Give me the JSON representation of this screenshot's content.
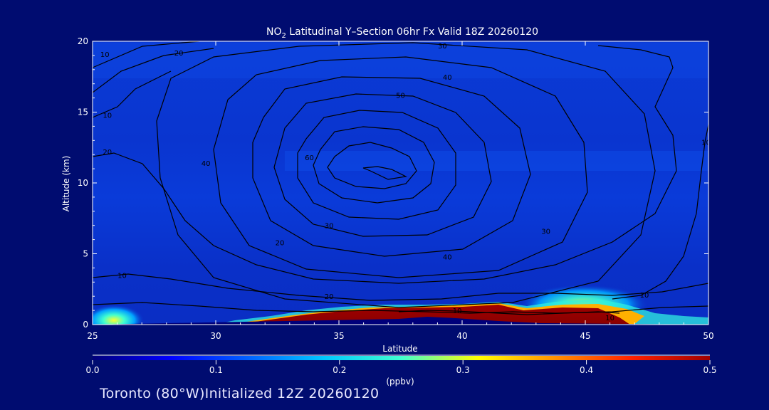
{
  "chart_data": {
    "type": "heatmap",
    "title_prefix": "NO",
    "title_sub": "2",
    "title_rest": " Latitudinal Y–Section 06hr  Fx Valid 18Z 20260120",
    "xlabel": "Latitude",
    "ylabel": "Altitude (km)",
    "xlim": [
      25,
      50
    ],
    "ylim": [
      0,
      20
    ],
    "xticks": [
      "25",
      "30",
      "35",
      "40",
      "45",
      "50"
    ],
    "yticks": [
      "0",
      "5",
      "10",
      "15",
      "20"
    ],
    "colorbar": {
      "label": "(ppbv)",
      "range": [
        0.0,
        0.5
      ],
      "ticks": [
        "0.0",
        "0.1",
        "0.2",
        "0.3",
        "0.4",
        "0.5"
      ],
      "colors": [
        "#00007a",
        "#0000ff",
        "#0060ff",
        "#00c8ff",
        "#40ffd0",
        "#ffff00",
        "#ff9000",
        "#ff2000",
        "#a00000"
      ]
    },
    "contour_labels": [
      {
        "text": "10",
        "x": 25.5,
        "y": 19.1
      },
      {
        "text": "20",
        "x": 28.5,
        "y": 19.2
      },
      {
        "text": "30",
        "x": 39.2,
        "y": 19.7
      },
      {
        "text": "40",
        "x": 39.4,
        "y": 17.5
      },
      {
        "text": "50",
        "x": 37.5,
        "y": 16.2
      },
      {
        "text": "10",
        "x": 25.6,
        "y": 14.8
      },
      {
        "text": "20",
        "x": 25.6,
        "y": 12.2
      },
      {
        "text": "40",
        "x": 29.6,
        "y": 11.4
      },
      {
        "text": "60",
        "x": 33.8,
        "y": 11.8
      },
      {
        "text": "30",
        "x": 34.6,
        "y": 7.0
      },
      {
        "text": "20",
        "x": 32.6,
        "y": 5.8
      },
      {
        "text": "10",
        "x": 26.2,
        "y": 3.5
      },
      {
        "text": "20",
        "x": 34.6,
        "y": 2.0
      },
      {
        "text": "40",
        "x": 39.4,
        "y": 4.8
      },
      {
        "text": "30",
        "x": 43.4,
        "y": 6.6
      },
      {
        "text": "10",
        "x": 49.9,
        "y": 12.9
      },
      {
        "text": "10",
        "x": 47.4,
        "y": 2.1
      },
      {
        "text": "10",
        "x": 39.8,
        "y": 1.0
      },
      {
        "text": "10",
        "x": 46.0,
        "y": 0.5
      }
    ]
  },
  "footer": "Toronto (80°W)Initialized 12Z 20260120"
}
